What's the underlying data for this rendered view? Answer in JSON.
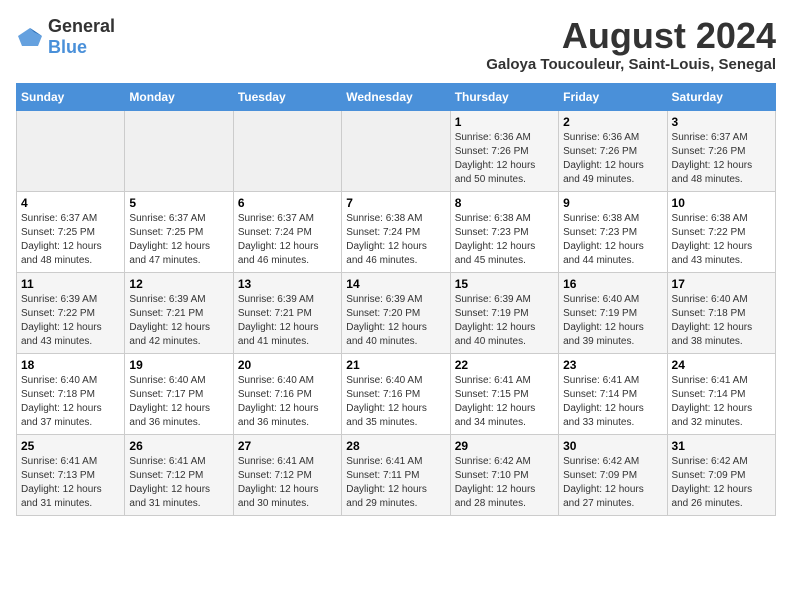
{
  "logo": {
    "general": "General",
    "blue": "Blue"
  },
  "title": "August 2024",
  "subtitle": "Galoya Toucouleur, Saint-Louis, Senegal",
  "days_of_week": [
    "Sunday",
    "Monday",
    "Tuesday",
    "Wednesday",
    "Thursday",
    "Friday",
    "Saturday"
  ],
  "weeks": [
    [
      {
        "day": "",
        "info": ""
      },
      {
        "day": "",
        "info": ""
      },
      {
        "day": "",
        "info": ""
      },
      {
        "day": "",
        "info": ""
      },
      {
        "day": "1",
        "info": "Sunrise: 6:36 AM\nSunset: 7:26 PM\nDaylight: 12 hours\nand 50 minutes."
      },
      {
        "day": "2",
        "info": "Sunrise: 6:36 AM\nSunset: 7:26 PM\nDaylight: 12 hours\nand 49 minutes."
      },
      {
        "day": "3",
        "info": "Sunrise: 6:37 AM\nSunset: 7:26 PM\nDaylight: 12 hours\nand 48 minutes."
      }
    ],
    [
      {
        "day": "4",
        "info": "Sunrise: 6:37 AM\nSunset: 7:25 PM\nDaylight: 12 hours\nand 48 minutes."
      },
      {
        "day": "5",
        "info": "Sunrise: 6:37 AM\nSunset: 7:25 PM\nDaylight: 12 hours\nand 47 minutes."
      },
      {
        "day": "6",
        "info": "Sunrise: 6:37 AM\nSunset: 7:24 PM\nDaylight: 12 hours\nand 46 minutes."
      },
      {
        "day": "7",
        "info": "Sunrise: 6:38 AM\nSunset: 7:24 PM\nDaylight: 12 hours\nand 46 minutes."
      },
      {
        "day": "8",
        "info": "Sunrise: 6:38 AM\nSunset: 7:23 PM\nDaylight: 12 hours\nand 45 minutes."
      },
      {
        "day": "9",
        "info": "Sunrise: 6:38 AM\nSunset: 7:23 PM\nDaylight: 12 hours\nand 44 minutes."
      },
      {
        "day": "10",
        "info": "Sunrise: 6:38 AM\nSunset: 7:22 PM\nDaylight: 12 hours\nand 43 minutes."
      }
    ],
    [
      {
        "day": "11",
        "info": "Sunrise: 6:39 AM\nSunset: 7:22 PM\nDaylight: 12 hours\nand 43 minutes."
      },
      {
        "day": "12",
        "info": "Sunrise: 6:39 AM\nSunset: 7:21 PM\nDaylight: 12 hours\nand 42 minutes."
      },
      {
        "day": "13",
        "info": "Sunrise: 6:39 AM\nSunset: 7:21 PM\nDaylight: 12 hours\nand 41 minutes."
      },
      {
        "day": "14",
        "info": "Sunrise: 6:39 AM\nSunset: 7:20 PM\nDaylight: 12 hours\nand 40 minutes."
      },
      {
        "day": "15",
        "info": "Sunrise: 6:39 AM\nSunset: 7:19 PM\nDaylight: 12 hours\nand 40 minutes."
      },
      {
        "day": "16",
        "info": "Sunrise: 6:40 AM\nSunset: 7:19 PM\nDaylight: 12 hours\nand 39 minutes."
      },
      {
        "day": "17",
        "info": "Sunrise: 6:40 AM\nSunset: 7:18 PM\nDaylight: 12 hours\nand 38 minutes."
      }
    ],
    [
      {
        "day": "18",
        "info": "Sunrise: 6:40 AM\nSunset: 7:18 PM\nDaylight: 12 hours\nand 37 minutes."
      },
      {
        "day": "19",
        "info": "Sunrise: 6:40 AM\nSunset: 7:17 PM\nDaylight: 12 hours\nand 36 minutes."
      },
      {
        "day": "20",
        "info": "Sunrise: 6:40 AM\nSunset: 7:16 PM\nDaylight: 12 hours\nand 36 minutes."
      },
      {
        "day": "21",
        "info": "Sunrise: 6:40 AM\nSunset: 7:16 PM\nDaylight: 12 hours\nand 35 minutes."
      },
      {
        "day": "22",
        "info": "Sunrise: 6:41 AM\nSunset: 7:15 PM\nDaylight: 12 hours\nand 34 minutes."
      },
      {
        "day": "23",
        "info": "Sunrise: 6:41 AM\nSunset: 7:14 PM\nDaylight: 12 hours\nand 33 minutes."
      },
      {
        "day": "24",
        "info": "Sunrise: 6:41 AM\nSunset: 7:14 PM\nDaylight: 12 hours\nand 32 minutes."
      }
    ],
    [
      {
        "day": "25",
        "info": "Sunrise: 6:41 AM\nSunset: 7:13 PM\nDaylight: 12 hours\nand 31 minutes."
      },
      {
        "day": "26",
        "info": "Sunrise: 6:41 AM\nSunset: 7:12 PM\nDaylight: 12 hours\nand 31 minutes."
      },
      {
        "day": "27",
        "info": "Sunrise: 6:41 AM\nSunset: 7:12 PM\nDaylight: 12 hours\nand 30 minutes."
      },
      {
        "day": "28",
        "info": "Sunrise: 6:41 AM\nSunset: 7:11 PM\nDaylight: 12 hours\nand 29 minutes."
      },
      {
        "day": "29",
        "info": "Sunrise: 6:42 AM\nSunset: 7:10 PM\nDaylight: 12 hours\nand 28 minutes."
      },
      {
        "day": "30",
        "info": "Sunrise: 6:42 AM\nSunset: 7:09 PM\nDaylight: 12 hours\nand 27 minutes."
      },
      {
        "day": "31",
        "info": "Sunrise: 6:42 AM\nSunset: 7:09 PM\nDaylight: 12 hours\nand 26 minutes."
      }
    ]
  ]
}
